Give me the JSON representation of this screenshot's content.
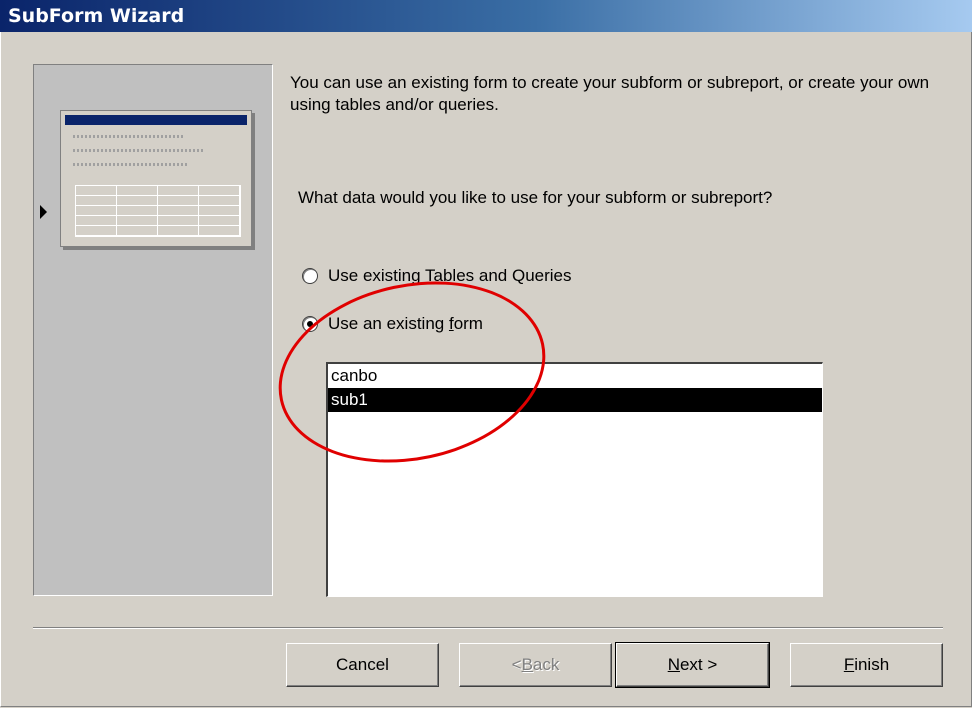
{
  "window": {
    "title": "SubForm Wizard"
  },
  "instruction": "You can use an existing form to create your subform or subreport, or create your own using tables and/or queries.",
  "question": "What data would you like to use for your subform or subreport?",
  "options": [
    {
      "label_pre": "Use existing ",
      "accel": "T",
      "label_post": "ables and Queries",
      "checked": false
    },
    {
      "label_pre": "Use an existing ",
      "accel": "f",
      "label_post": "orm",
      "checked": true
    }
  ],
  "forms_list": [
    {
      "name": "canbo",
      "selected": false
    },
    {
      "name": "sub1",
      "selected": true
    }
  ],
  "buttons": {
    "cancel": "Cancel",
    "back_pre": "< ",
    "back_accel": "B",
    "back_post": "ack",
    "next_accel": "N",
    "next_post": "ext >",
    "finish_accel": "F",
    "finish_post": "inish"
  },
  "annotation_color": "#e00000"
}
